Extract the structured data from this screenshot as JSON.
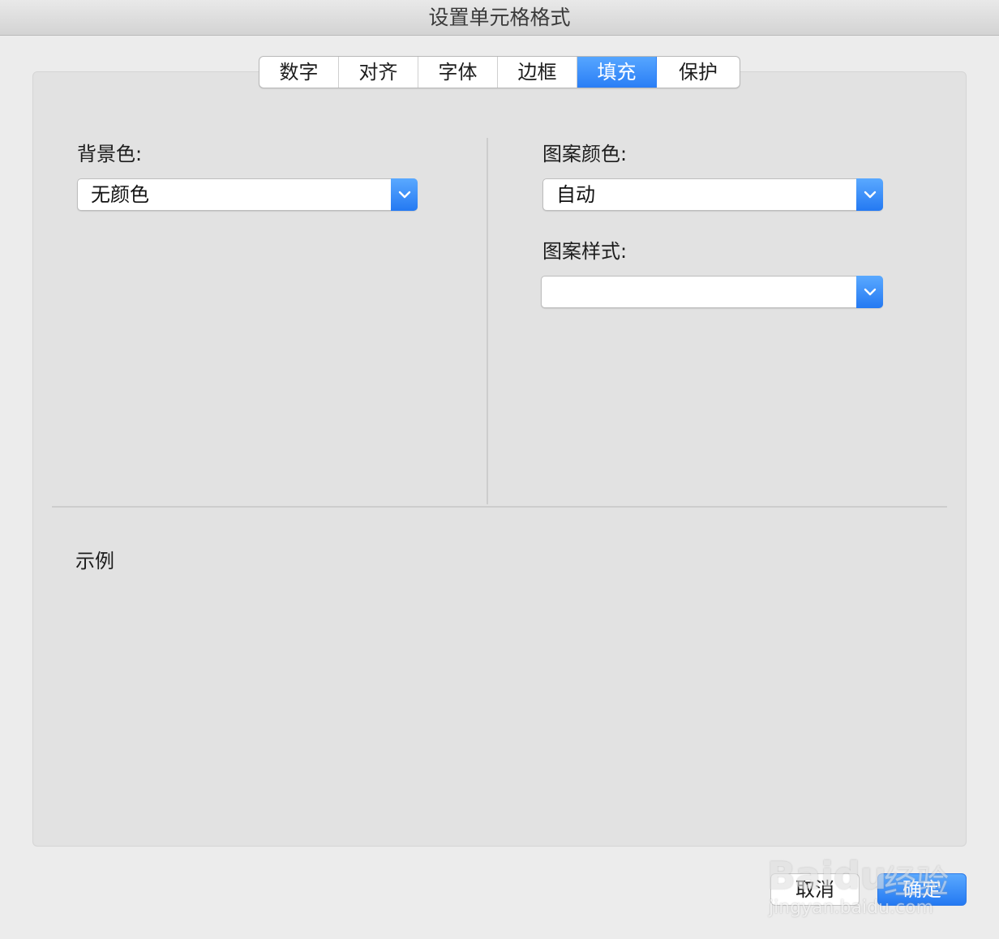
{
  "window": {
    "title": "设置单元格格式"
  },
  "tabs": [
    {
      "label": "数字"
    },
    {
      "label": "对齐"
    },
    {
      "label": "字体"
    },
    {
      "label": "边框"
    },
    {
      "label": "填充"
    },
    {
      "label": "保护"
    }
  ],
  "active_tab": "填充",
  "fill": {
    "background_color_label": "背景色:",
    "background_color_value": "无颜色",
    "pattern_color_label": "图案颜色:",
    "pattern_color_value": "自动",
    "pattern_style_label": "图案样式:",
    "pattern_style_value": ""
  },
  "sample": {
    "label": "示例"
  },
  "buttons": {
    "cancel": "取消",
    "ok": "确定"
  },
  "watermark": {
    "logo": "Baidu",
    "cn": "经验",
    "url": "jingyan.baidu.com"
  },
  "colors": {
    "accent": "#2a7ef6",
    "panel": "#e2e2e2",
    "window": "#ececec"
  },
  "icons": {
    "dropdown": "chevron-down-icon"
  }
}
